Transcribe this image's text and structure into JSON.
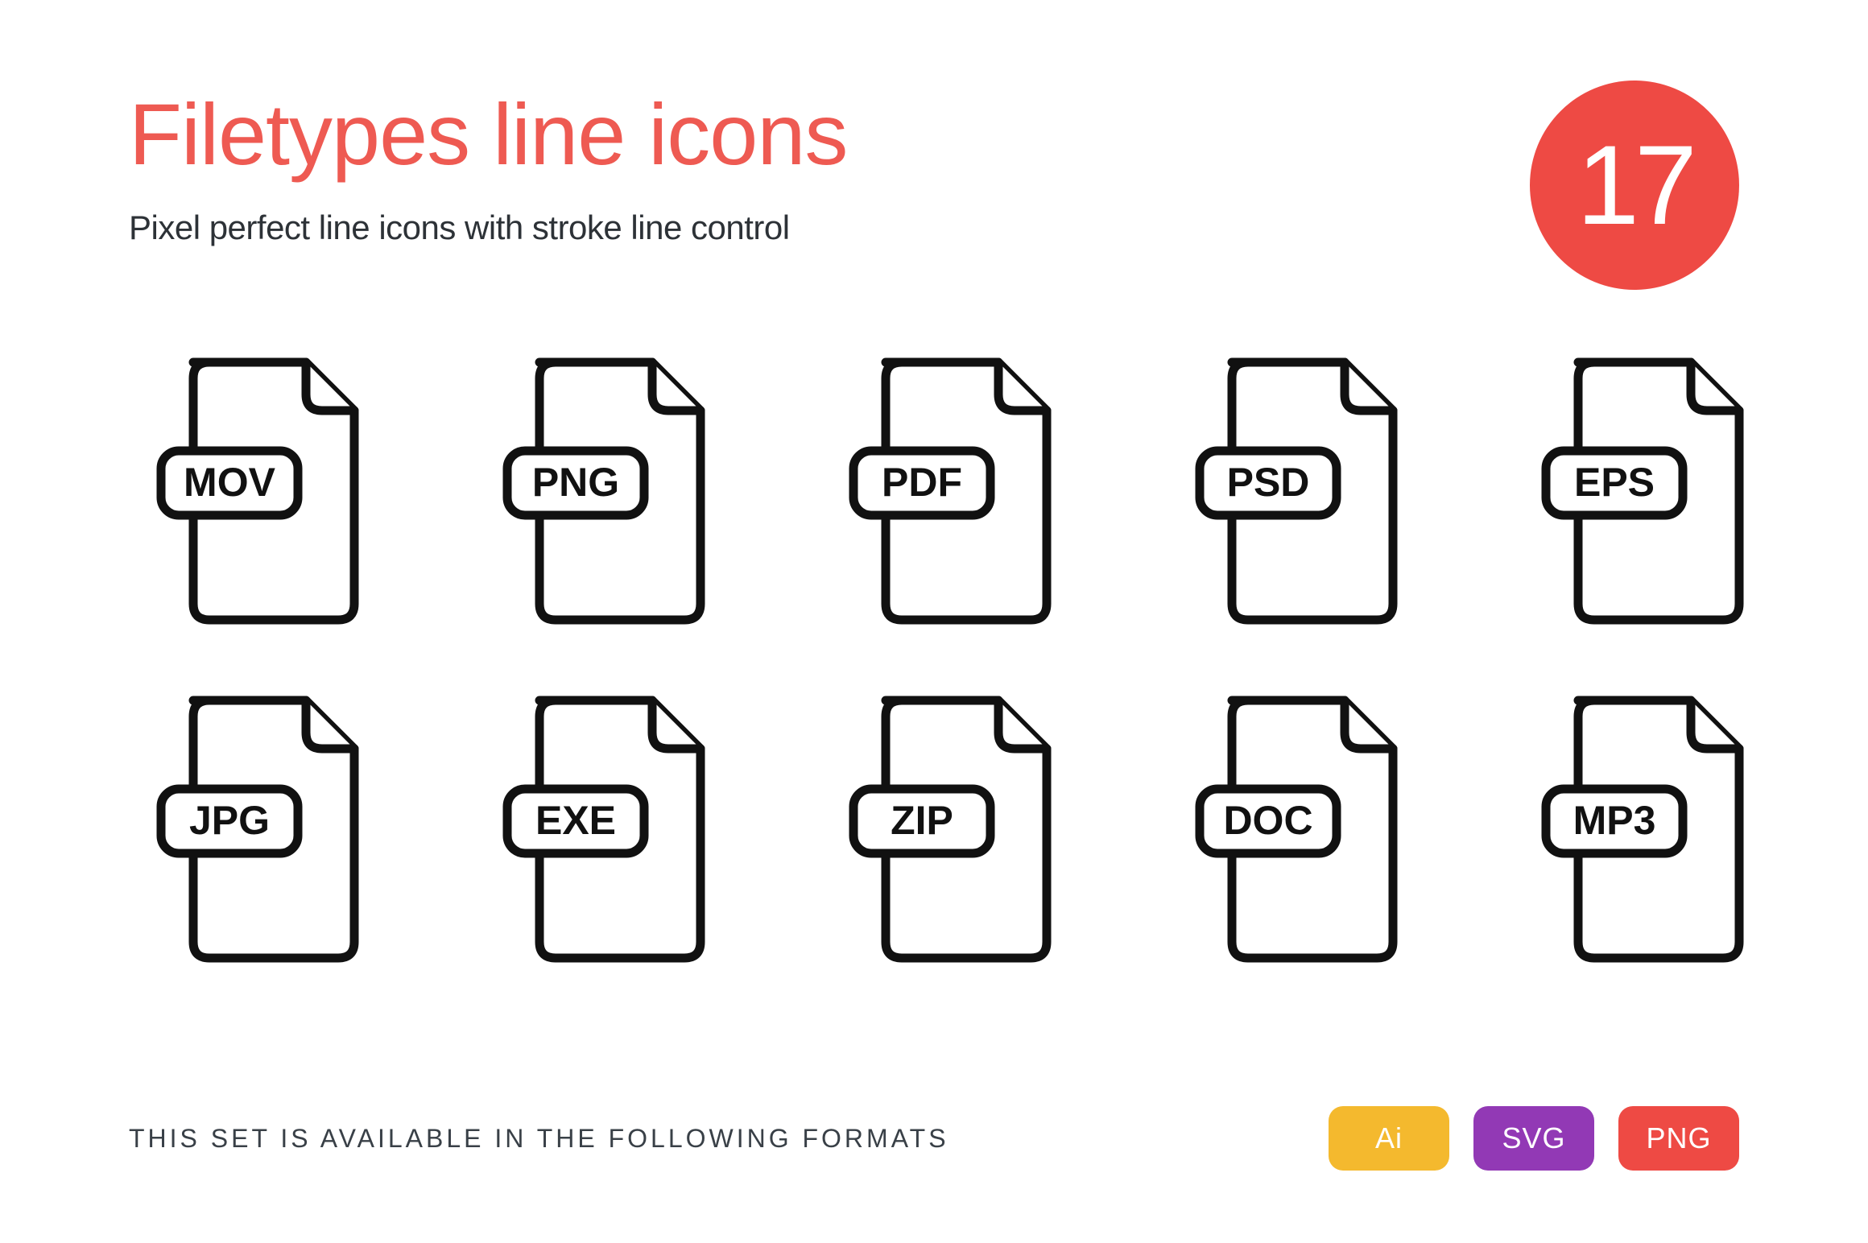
{
  "title": "Filetypes line icons",
  "subtitle": "Pixel perfect line icons with stroke line control",
  "count": "17",
  "icons": [
    {
      "label": "MOV"
    },
    {
      "label": "PNG"
    },
    {
      "label": "PDF"
    },
    {
      "label": "PSD"
    },
    {
      "label": "EPS"
    },
    {
      "label": "JPG"
    },
    {
      "label": "EXE"
    },
    {
      "label": "ZIP"
    },
    {
      "label": "DOC"
    },
    {
      "label": "MP3"
    }
  ],
  "footer_text": "THIS SET IS AVAILABLE IN THE FOLLOWING FORMATS",
  "formats": [
    {
      "label": "Ai",
      "class": "ai"
    },
    {
      "label": "SVG",
      "class": "svg"
    },
    {
      "label": "PNG",
      "class": "png"
    }
  ],
  "colors": {
    "accent_red": "#ee4a44",
    "title_red": "#ee5a52",
    "badge_yellow": "#f4b92e",
    "badge_purple": "#9239b5"
  }
}
